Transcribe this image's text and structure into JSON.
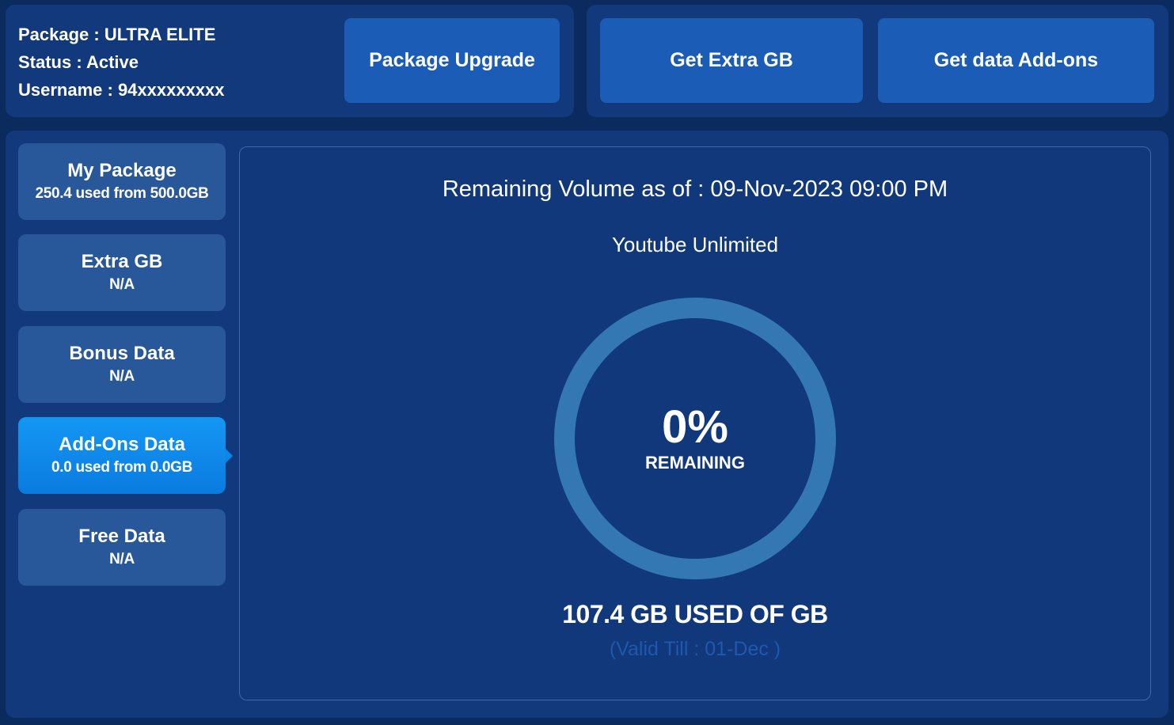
{
  "account": {
    "package_line": "Package : ULTRA ELITE",
    "status_line": "Status : Active",
    "username_line": "Username : 94xxxxxxxxx"
  },
  "actions": {
    "package_upgrade": "Package Upgrade",
    "get_extra_gb": "Get Extra GB",
    "get_data_addons": "Get data Add-ons"
  },
  "sidebar": {
    "items": [
      {
        "title": "My Package",
        "subtitle": "250.4 used from 500.0GB",
        "active": false
      },
      {
        "title": "Extra GB",
        "subtitle": "N/A",
        "active": false
      },
      {
        "title": "Bonus Data",
        "subtitle": "N/A",
        "active": false
      },
      {
        "title": "Add-Ons Data",
        "subtitle": "0.0 used from 0.0GB",
        "active": true
      },
      {
        "title": "Free Data",
        "subtitle": "N/A",
        "active": false
      }
    ]
  },
  "usage": {
    "title": "Remaining Volume as of : 09-Nov-2023 09:00 PM",
    "package_name": "Youtube Unlimited",
    "percent_text": "0%",
    "remaining_percent": 0,
    "remaining_label": "REMAINING",
    "used_text": "107.4 GB USED OF GB",
    "valid_till": "(Valid Till : 01-Dec )"
  },
  "colors": {
    "background": "#0b2a5e",
    "panel": "#11397b",
    "button": "#1b5db6",
    "sidebar_item": "#28579a",
    "active_item": "#0a85e8",
    "gauge_ring": "#3377b3",
    "valid_text": "#1f58ae"
  }
}
